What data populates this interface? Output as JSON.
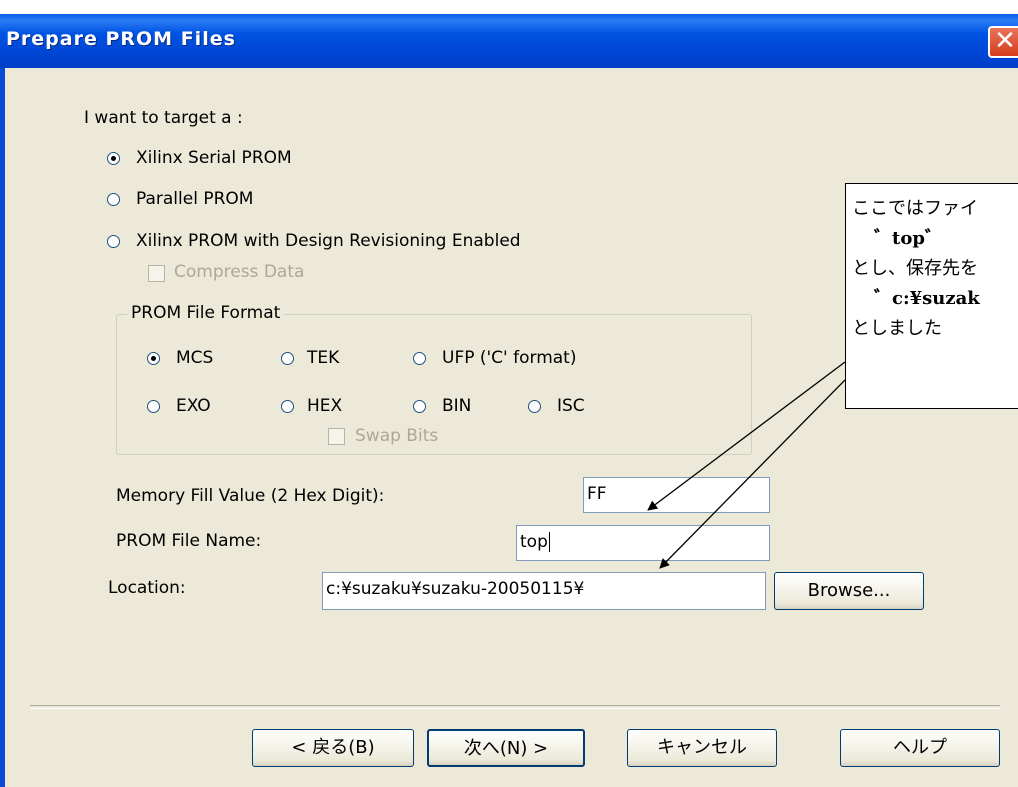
{
  "window": {
    "title": "Prepare PROM Files",
    "close_glyph": "✕"
  },
  "target": {
    "label": "I want to target a :",
    "options": [
      {
        "label": "Xilinx Serial PROM",
        "checked": true
      },
      {
        "label": "Parallel PROM",
        "checked": false
      },
      {
        "label": "Xilinx PROM with Design Revisioning Enabled",
        "checked": false
      }
    ],
    "compress_label": "Compress Data"
  },
  "format": {
    "title": "PROM File Format",
    "options": [
      {
        "label": "MCS",
        "checked": true
      },
      {
        "label": "TEK",
        "checked": false
      },
      {
        "label": "UFP ('C' format)",
        "checked": false
      },
      {
        "label": "EXO",
        "checked": false
      },
      {
        "label": "HEX",
        "checked": false
      },
      {
        "label": "BIN",
        "checked": false
      },
      {
        "label": "ISC",
        "checked": false
      }
    ],
    "swap_label": "Swap Bits"
  },
  "fields": {
    "fill_label": "Memory Fill Value (2 Hex Digit):",
    "fill_value": "FF",
    "name_label": "PROM File Name:",
    "name_value": "top",
    "location_label": "Location:",
    "location_value": "c:¥suzaku¥suzaku-20050115¥",
    "browse_label": "Browse..."
  },
  "buttons": {
    "back_label": "< 戻る(B)",
    "next_label": "次へ(N) >",
    "cancel_label": "キャンセル",
    "help_label": "ヘルプ"
  },
  "callout": {
    "line1": "ここではファイ",
    "line2": "゛top゛",
    "line3": "とし、保存先を",
    "line4": "゛c:¥suzak",
    "line5": "としました"
  },
  "colors": {
    "title_bar": "#0054e3",
    "dialog_bg": "#ece9d8",
    "close": "#d63c1c"
  }
}
